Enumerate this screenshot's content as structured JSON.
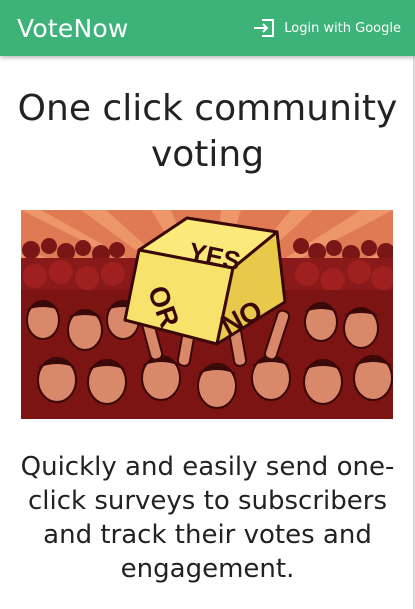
{
  "navbar": {
    "brand": "VoteNow",
    "login_label": "Login with Google",
    "login_icon": "login-icon"
  },
  "hero": {
    "title": "One click community voting",
    "image": {
      "icon": "crowd-voting-illustration",
      "die_text": {
        "yes": "YES",
        "or": "OR",
        "no": "NO"
      }
    }
  },
  "tagline": "Quickly and easily send one-click surveys to subscribers and track their votes and engagement.",
  "colors": {
    "brand": "#3db37a",
    "background": "#ffffff",
    "text": "#222222",
    "image_background": "#e06a4a",
    "crowd": "#8a1a1a",
    "die": "#f7e36b"
  }
}
